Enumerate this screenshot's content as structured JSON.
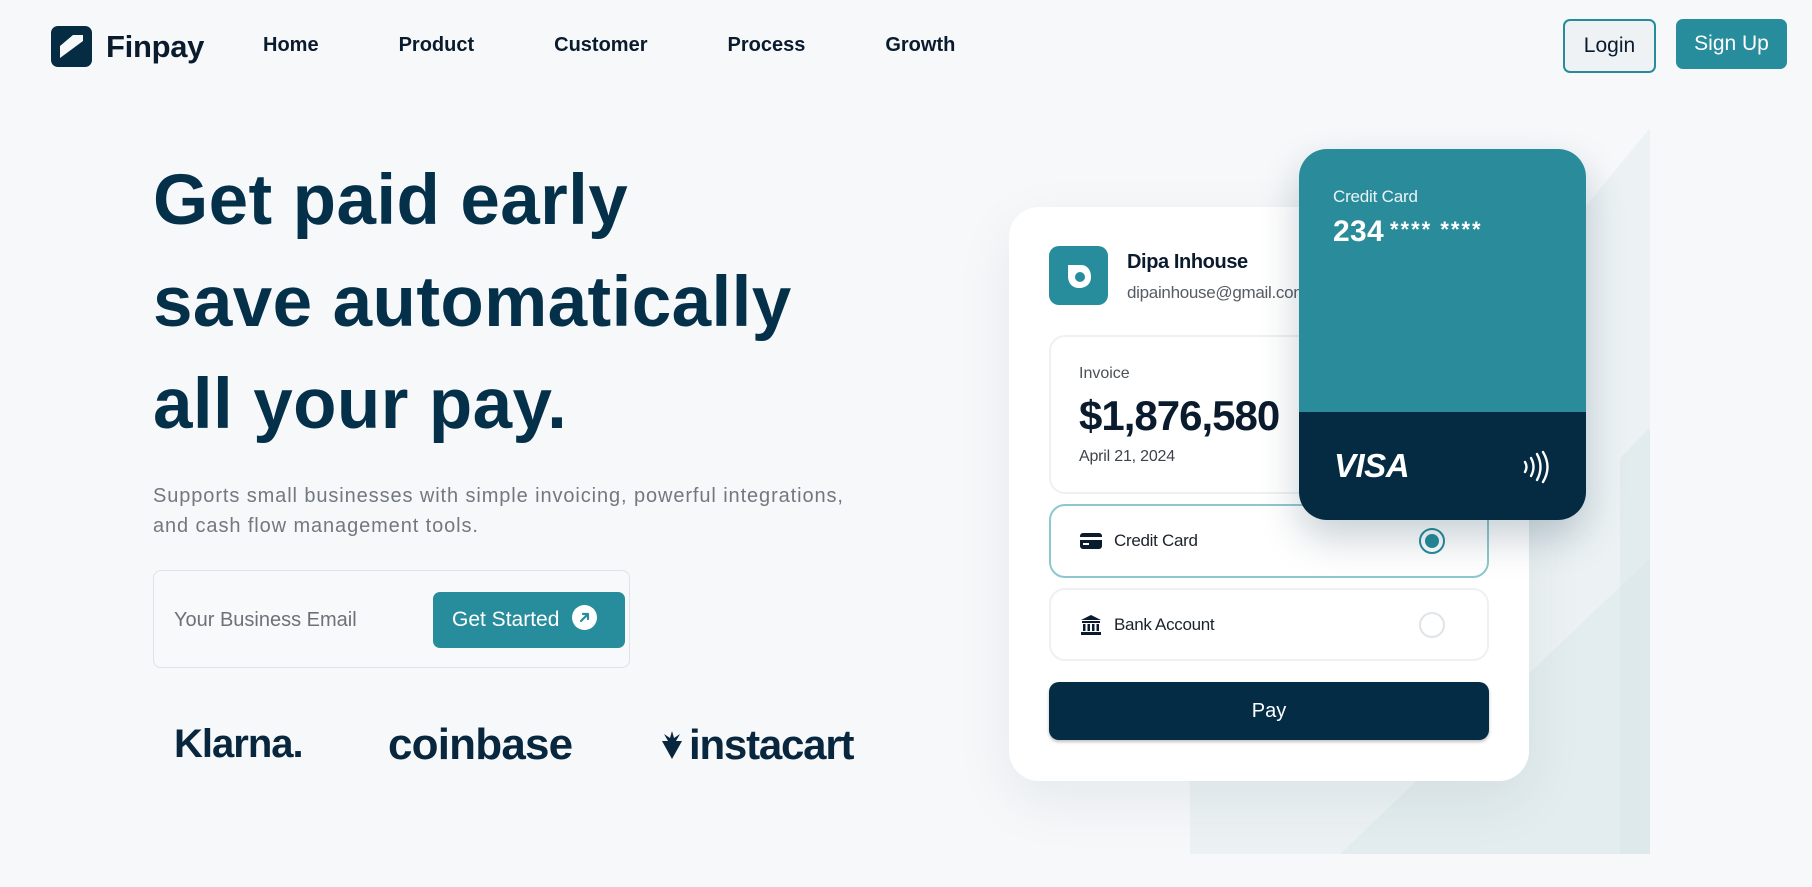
{
  "nav": {
    "brand": "Finpay",
    "links": [
      "Home",
      "Product",
      "Customer",
      "Process",
      "Growth"
    ],
    "login_label": "Login",
    "signup_label": "Sign Up"
  },
  "hero": {
    "headline": [
      "Get paid early",
      "save automatically",
      "all your pay."
    ],
    "subtext_line1": "Supports small businesses with simple invoicing, powerful integrations,",
    "subtext_line2": "and cash flow management tools.",
    "email_placeholder": "Your Business Email",
    "cta_label": "Get Started"
  },
  "brands": {
    "klarna": "Klarna.",
    "coinbase": "coinbase",
    "instacart": "instacart"
  },
  "payment_card": {
    "name": "Dipa Inhouse",
    "email": "dipainhouse@gmail.com",
    "invoice_label": "Invoice",
    "invoice_amount": "$1,876,580",
    "invoice_date": "April 21, 2024",
    "options": [
      {
        "label": "Credit Card",
        "selected": true,
        "icon": "credit-card-icon"
      },
      {
        "label": "Bank Account",
        "selected": false,
        "icon": "bank-icon"
      }
    ],
    "pay_label": "Pay"
  },
  "credit_card": {
    "label": "Credit Card",
    "number_prefix": "234",
    "number_masked": "**** ****",
    "network": "VISA"
  },
  "colors": {
    "accent": "#278c9b",
    "navy": "#05304a",
    "dark_navy": "#042d45",
    "background": "#f6f8fa"
  }
}
